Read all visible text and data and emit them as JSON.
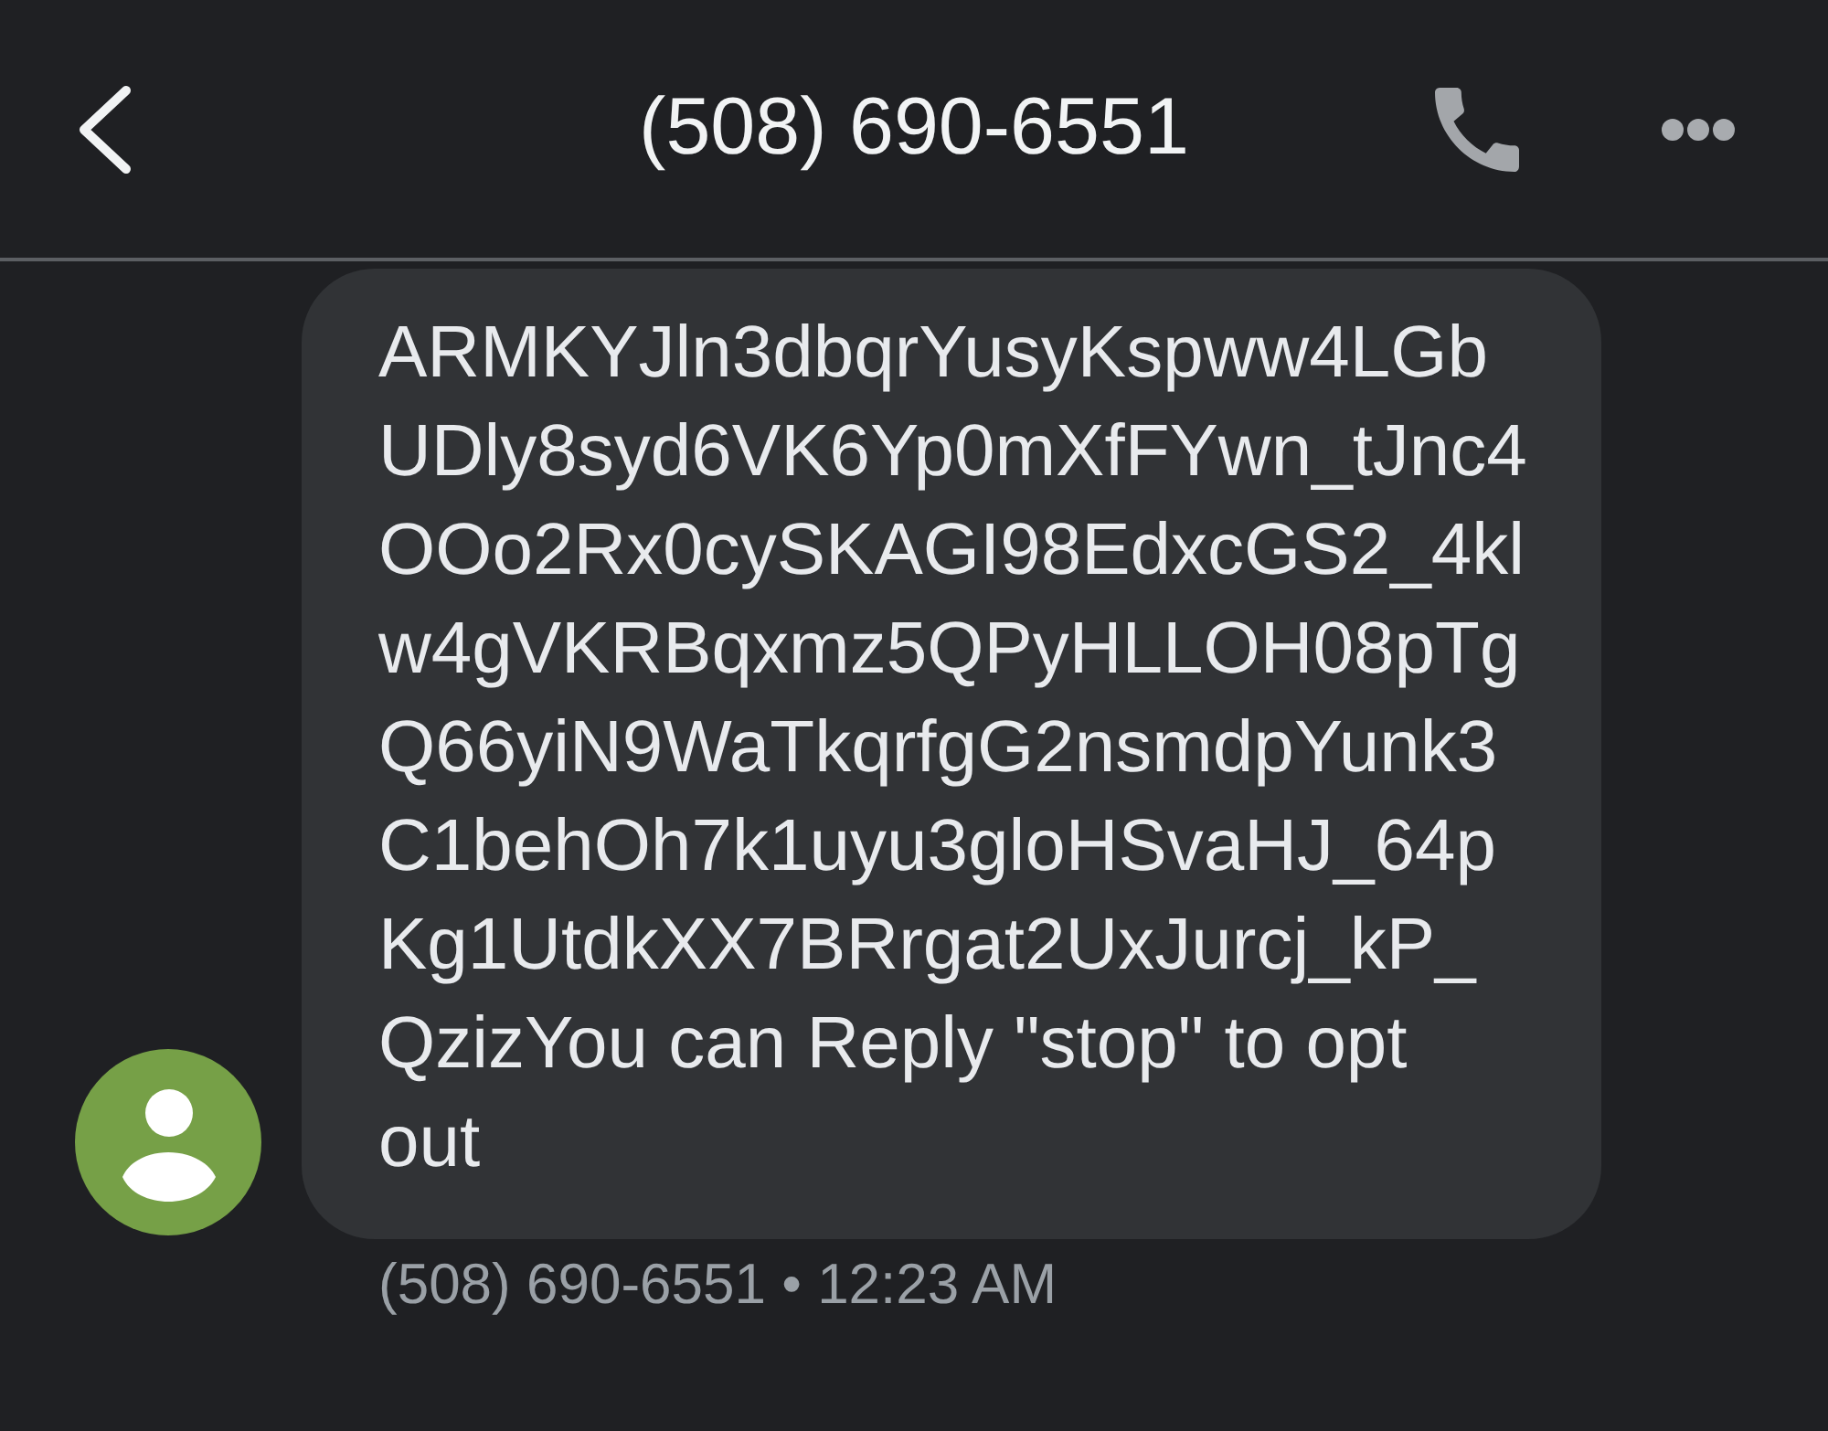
{
  "header": {
    "title": "(508) 690-6551"
  },
  "messages": [
    {
      "text": "ARMKYJln3dbqrYusyKspww4LGbUDly8syd6VK6Yp0mXfFYwn_tJnc4OOo2Rx0cySKAGI98EdxcGS2_4klw4gVKRBqxmz5QPyHLLOH08pTgQ66yiN9WaTkqrfgG2nsmdpYunk3C1behOh7k1uyu3gloHSvaHJ_64pKg1UtdkXX7BRrgat2UxJurcj_kP_QzizYou can Reply \"stop\" to opt out",
      "meta": "(508) 690-6551 • 12:23 AM"
    }
  ]
}
